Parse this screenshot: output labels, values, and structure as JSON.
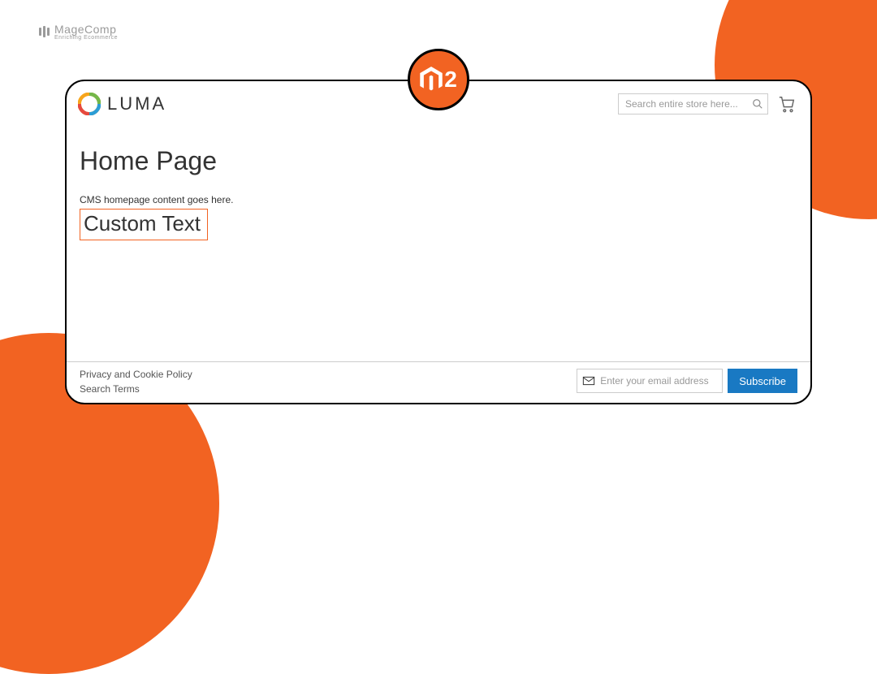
{
  "brand": {
    "name": "MageComp",
    "tagline": "Enriching Ecommerce"
  },
  "badge": {
    "suffix": "2"
  },
  "header": {
    "logo_text": "LUMA",
    "search_placeholder": "Search entire store here..."
  },
  "main": {
    "page_title": "Home Page",
    "cms_note": "CMS homepage content goes here.",
    "custom_text": "Custom Text"
  },
  "footer": {
    "links": [
      "Privacy and Cookie Policy",
      "Search Terms"
    ],
    "newsletter_placeholder": "Enter your email address",
    "subscribe_label": "Subscribe"
  }
}
